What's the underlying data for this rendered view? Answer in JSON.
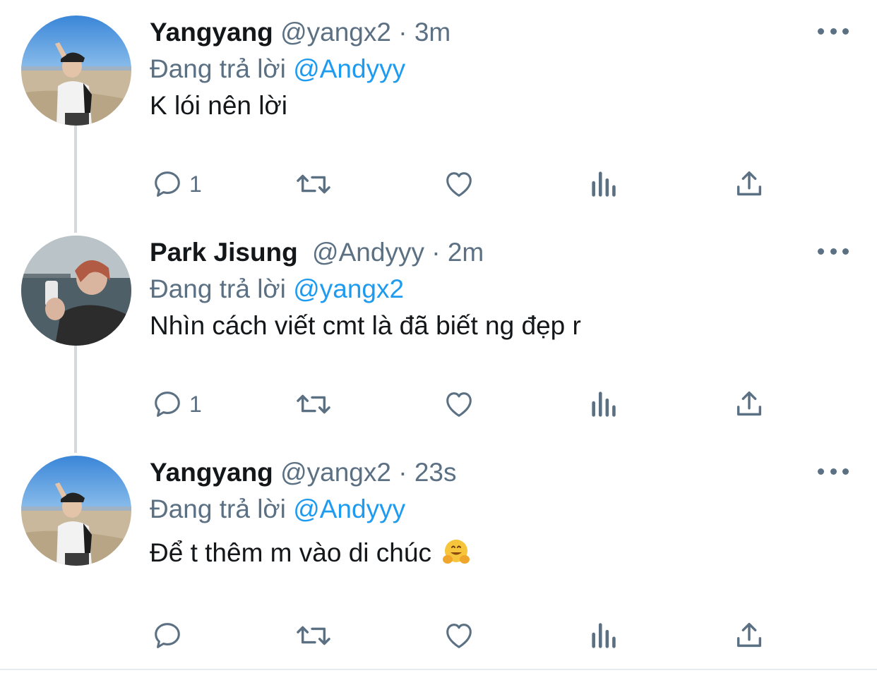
{
  "reply_prefix": "Đang trả lời",
  "colors": {
    "accent": "#1d9bf0",
    "secondary": "#5b7083",
    "text": "#14171a",
    "thread_line": "#d4d9dd"
  },
  "tweets": [
    {
      "name": "Yangyang",
      "handle": "@yangx2",
      "sep": " · ",
      "time": "3m",
      "reply_to": "@Andyyy",
      "text": "K lói nên lời",
      "emoji": "",
      "reply_count": "1",
      "avatar_icon": "avatar-beach-photo"
    },
    {
      "name": "Park Jisung",
      "handle": "@Andyyy",
      "sep": " · ",
      "time": "2m",
      "reply_to": "@yangx2",
      "text": "Nhìn cách viết cmt là đã biết ng đẹp r",
      "emoji": "",
      "reply_count": "1",
      "avatar_icon": "avatar-seaside-photo"
    },
    {
      "name": "Yangyang",
      "handle": "@yangx2",
      "sep": " · ",
      "time": "23s",
      "reply_to": "@Andyyy",
      "text": "Để t thêm m vào di chúc",
      "emoji": "hugging-face-emoji",
      "reply_count": "",
      "avatar_icon": "avatar-beach-photo"
    }
  ]
}
